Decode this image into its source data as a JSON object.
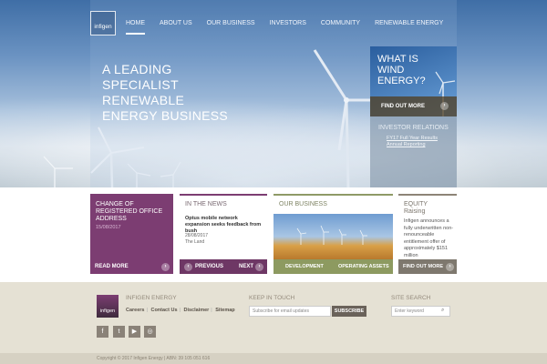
{
  "header": {
    "logo_text": "infigen",
    "nav": [
      "HOME",
      "ABOUT US",
      "OUR BUSINESS",
      "INVESTORS",
      "COMMUNITY",
      "RENEWABLE ENERGY"
    ]
  },
  "hero": {
    "title_lines": [
      "A LEADING",
      "SPECIALIST",
      "RENEWABLE",
      "ENERGY BUSINESS"
    ],
    "panel_question": [
      "WHAT IS",
      "WIND",
      "ENERGY?"
    ],
    "panel_button": "FIND OUT MORE",
    "ir_heading": "INVESTOR RELATIONS",
    "ir_link": "FY17 Full Year Results Annual Reporting"
  },
  "cards": {
    "office": {
      "title": "CHANGE OF REGISTERED OFFICE ADDRESS",
      "date": "15/08/2017",
      "footer": "READ MORE"
    },
    "news": {
      "heading": "IN THE NEWS",
      "headline": "Optus mobile network expansion seeks feedback from bush",
      "date": "28/08/2017",
      "source": "The Land",
      "prev": "PREVIOUS",
      "next": "NEXT"
    },
    "business": {
      "heading": "OUR BUSINESS",
      "btn_left": "DEVELOPMENT",
      "btn_right": "OPERATING ASSETS"
    },
    "equity": {
      "heading": "EQUITY Raising",
      "body": "Infigen announces a fully underwritten non-renounceable entitlement offer of approximately $151 million",
      "footer": "FIND OUT MORE"
    }
  },
  "footer": {
    "brand_title": "INFIGEN ENERGY",
    "links": [
      "Careers",
      "Contact Us",
      "Disclaimer",
      "Sitemap"
    ],
    "social_icons": [
      "facebook-icon",
      "twitter-icon",
      "youtube-icon",
      "instagram-icon"
    ],
    "keep_title": "KEEP IN TOUCH",
    "email_placeholder": "Subscribe for email updates",
    "subscribe_label": "SUBSCRIBE",
    "search_title": "SITE SEARCH",
    "search_placeholder": "Enter keyword",
    "copyright": "Copyright © 2017 Infigen Energy   |   ABN: 39 105 051 616"
  },
  "colors": {
    "purple": "#7c3d72",
    "olive": "#8d9a60",
    "taupe": "#7e786e",
    "footer_bg": "#e5e1d4"
  }
}
